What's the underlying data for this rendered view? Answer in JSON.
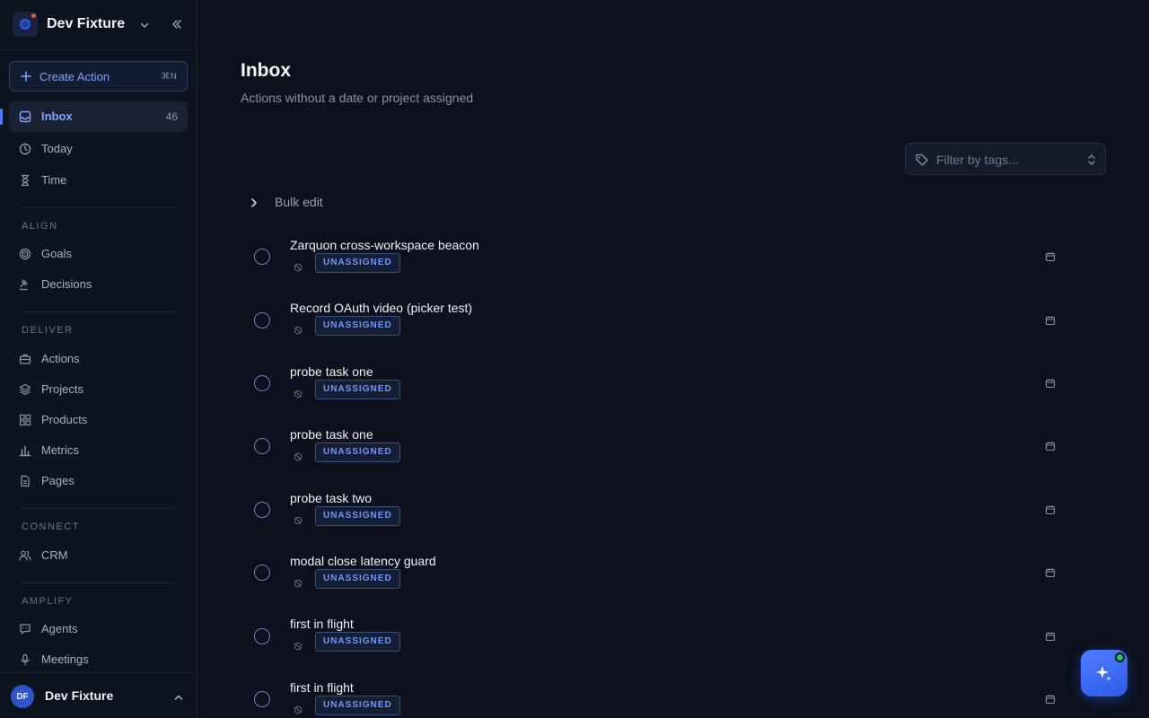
{
  "workspace": {
    "name": "Dev Fixture"
  },
  "create": {
    "label": "Create Action",
    "shortcut": "⌘N"
  },
  "nav": {
    "inbox": {
      "label": "Inbox",
      "count": "46"
    },
    "today": {
      "label": "Today"
    },
    "time": {
      "label": "Time"
    },
    "goals": {
      "label": "Goals"
    },
    "decisions": {
      "label": "Decisions"
    },
    "actions": {
      "label": "Actions"
    },
    "projects": {
      "label": "Projects"
    },
    "products": {
      "label": "Products"
    },
    "metrics": {
      "label": "Metrics"
    },
    "pages": {
      "label": "Pages"
    },
    "crm": {
      "label": "CRM"
    },
    "agents": {
      "label": "Agents"
    },
    "meetings": {
      "label": "Meetings"
    }
  },
  "sections": {
    "align": "ALIGN",
    "deliver": "DELIVER",
    "connect": "CONNECT",
    "amplify": "AMPLIFY"
  },
  "user": {
    "initials": "DF",
    "name": "Dev Fixture"
  },
  "page": {
    "title": "Inbox",
    "subtitle": "Actions without a date or project assigned"
  },
  "filter": {
    "placeholder": "Filter by tags..."
  },
  "bulk_edit": {
    "label": "Bulk edit"
  },
  "tasks": [
    {
      "title": "Zarquon cross-workspace beacon",
      "badge": "UNASSIGNED"
    },
    {
      "title": "Record OAuth video (picker test)",
      "badge": "UNASSIGNED"
    },
    {
      "title": "probe task one",
      "badge": "UNASSIGNED"
    },
    {
      "title": "probe task one",
      "badge": "UNASSIGNED"
    },
    {
      "title": "probe task two",
      "badge": "UNASSIGNED"
    },
    {
      "title": "modal close latency guard",
      "badge": "UNASSIGNED"
    },
    {
      "title": "first in flight",
      "badge": "UNASSIGNED"
    },
    {
      "title": "first in flight",
      "badge": "UNASSIGNED"
    }
  ],
  "colors": {
    "accent": "#4d7cff",
    "badge_text": "#6f97ff",
    "checkbox": "#8475c7",
    "online": "#22c55e"
  },
  "icons": {
    "inbox": "inbox-icon",
    "today": "clock-icon",
    "time": "hourglass-icon",
    "goals": "target-icon",
    "decisions": "gavel-icon",
    "actions": "briefcase-icon",
    "projects": "layers-icon",
    "products": "grid-icon",
    "metrics": "bar-chart-icon",
    "pages": "file-icon",
    "crm": "users-icon",
    "agents": "chat-icon",
    "meetings": "mic-icon"
  }
}
